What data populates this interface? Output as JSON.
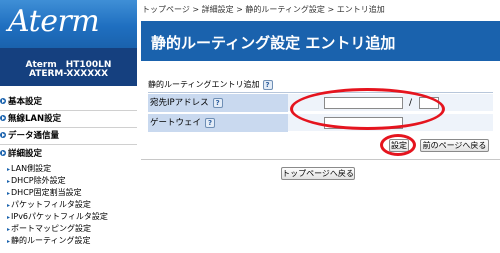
{
  "brand": {
    "logo": "Aterm",
    "model_line1": "Aterm　HT100LN",
    "model_line2": "ATERM-XXXXXX"
  },
  "sidebar": {
    "categories": [
      {
        "label": "基本設定"
      },
      {
        "label": "無線LAN設定"
      },
      {
        "label": "データ通信量"
      },
      {
        "label": "詳細設定"
      }
    ],
    "detail_items": [
      "LAN側設定",
      "DHCP除外設定",
      "DHCP固定割当設定",
      "パケットフィルタ設定",
      "IPv6パケットフィルタ設定",
      "ポートマッピング設定",
      "静的ルーティング設定"
    ]
  },
  "breadcrumb": "トップページ > 詳細設定 > 静的ルーティング設定 > エントリ追加",
  "page_title": "静的ルーティング設定 エントリ追加",
  "section": {
    "title": "静的ルーティングエントリ追加",
    "help": "?"
  },
  "form": {
    "dest_label": "宛先IPアドレス",
    "dest_help": "?",
    "dest_value": "",
    "slash": "/",
    "mask_value": "",
    "gateway_label": "ゲートウェイ",
    "gateway_help": "?",
    "gateway_value": ""
  },
  "buttons": {
    "submit": "設定",
    "back_prev": "前のページへ戻る",
    "back_top": "トップページへ戻る"
  },
  "colors": {
    "accent": "#1a62ad",
    "highlight_ring": "#e5141e"
  }
}
